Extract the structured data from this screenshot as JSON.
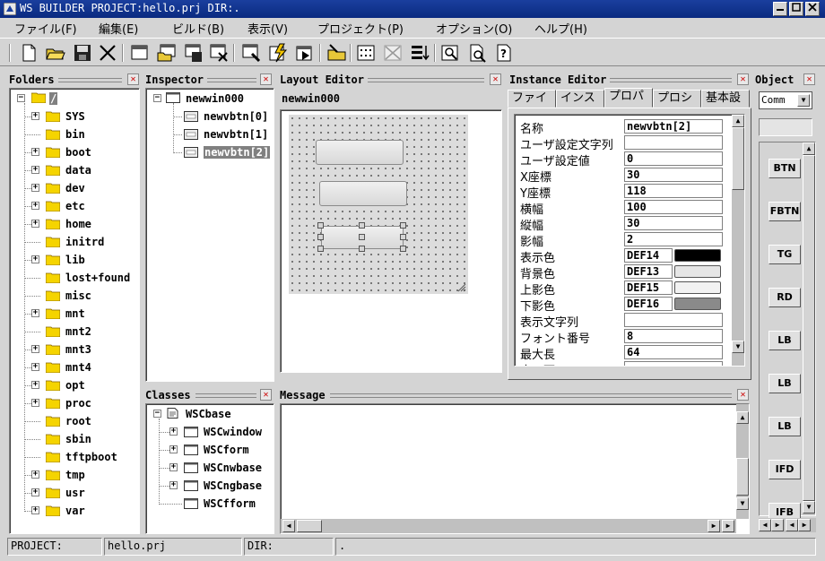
{
  "window": {
    "title": "WS BUILDER PROJECT:hello.prj DIR:."
  },
  "menu": [
    "ファイル(F)",
    "編集(E)",
    "ビルド(B)",
    "表示(V)",
    "プロジェクト(P)",
    "オプション(O)",
    "ヘルプ(H)"
  ],
  "toolbar_icons": [
    "new-file-icon",
    "open-folder-icon",
    "save-icon",
    "close-x-icon",
    "new-window-icon",
    "open-window-icon",
    "save-window-icon",
    "close-window-icon",
    "edit-window-icon",
    "build-icon",
    "run-icon",
    "folder-arrow-icon",
    "grid-icon",
    "grid-off-icon",
    "align-icon",
    "find-icon",
    "preview-icon",
    "help-icon"
  ],
  "folders": {
    "title": "Folders",
    "root": "/",
    "items": [
      {
        "label": "SYS",
        "expandable": true
      },
      {
        "label": "bin",
        "expandable": false
      },
      {
        "label": "boot",
        "expandable": true
      },
      {
        "label": "data",
        "expandable": true
      },
      {
        "label": "dev",
        "expandable": true
      },
      {
        "label": "etc",
        "expandable": true
      },
      {
        "label": "home",
        "expandable": true
      },
      {
        "label": "initrd",
        "expandable": false
      },
      {
        "label": "lib",
        "expandable": true
      },
      {
        "label": "lost+found",
        "expandable": false
      },
      {
        "label": "misc",
        "expandable": false
      },
      {
        "label": "mnt",
        "expandable": true
      },
      {
        "label": "mnt2",
        "expandable": false
      },
      {
        "label": "mnt3",
        "expandable": true
      },
      {
        "label": "mnt4",
        "expandable": true
      },
      {
        "label": "opt",
        "expandable": true
      },
      {
        "label": "proc",
        "expandable": true
      },
      {
        "label": "root",
        "expandable": false
      },
      {
        "label": "sbin",
        "expandable": false
      },
      {
        "label": "tftpboot",
        "expandable": false
      },
      {
        "label": "tmp",
        "expandable": true
      },
      {
        "label": "usr",
        "expandable": true
      },
      {
        "label": "var",
        "expandable": true
      }
    ]
  },
  "inspector": {
    "title": "Inspector",
    "root": "newwin000",
    "children": [
      "newvbtn[0]",
      "newvbtn[1]",
      "newvbtn[2]"
    ]
  },
  "layout_editor": {
    "title": "Layout Editor",
    "window_name": "newwin000"
  },
  "instance_editor": {
    "title": "Instance Editor",
    "tabs": [
      "ファイ",
      "インス",
      "プロパ",
      "プロシ",
      "基本設"
    ],
    "active_tab": 2,
    "properties": [
      {
        "name": "名称",
        "value": "newvbtn[2]"
      },
      {
        "name": "ユーザ設定文字列",
        "value": ""
      },
      {
        "name": "ユーザ設定値",
        "value": "0"
      },
      {
        "name": "X座標",
        "value": "30"
      },
      {
        "name": "Y座標",
        "value": "118"
      },
      {
        "name": "横幅",
        "value": "100"
      },
      {
        "name": "縦幅",
        "value": "30"
      },
      {
        "name": "影幅",
        "value": "2"
      },
      {
        "name": "表示色",
        "value": "DEF14",
        "color": "#000000"
      },
      {
        "name": "背景色",
        "value": "DEF13",
        "color": "#e6e6e6"
      },
      {
        "name": "上影色",
        "value": "DEF15",
        "color": "#f2f2f2"
      },
      {
        "name": "下影色",
        "value": "DEF16",
        "color": "#8a8a8a"
      },
      {
        "name": "表示文字列",
        "value": ""
      },
      {
        "name": "フォント番号",
        "value": "8"
      },
      {
        "name": "最大長",
        "value": "64"
      },
      {
        "name": "表示面",
        "value": ""
      }
    ]
  },
  "object_panel": {
    "title": "Object",
    "select_value": "Comm",
    "palette": [
      "BTN",
      "FBTN",
      "TG",
      "RD",
      "LB",
      "LB",
      "LB",
      "IFD",
      "IFB"
    ]
  },
  "classes": {
    "title": "Classes",
    "root": "WSCbase",
    "children": [
      {
        "label": "WSCwindow",
        "expandable": true
      },
      {
        "label": "WSCform",
        "expandable": true
      },
      {
        "label": "WSCnwbase",
        "expandable": true
      },
      {
        "label": "WSCngbase",
        "expandable": true
      },
      {
        "label": "WSCfform",
        "expandable": false
      }
    ]
  },
  "message": {
    "title": "Message"
  },
  "status": {
    "project_label": "PROJECT:",
    "project_value": "hello.prj",
    "dir_label": "DIR:",
    "dir_value": "."
  },
  "colors": {
    "titlebar": "#0a2a80",
    "window_bg": "#d4d4d4",
    "selection": "#808080"
  }
}
